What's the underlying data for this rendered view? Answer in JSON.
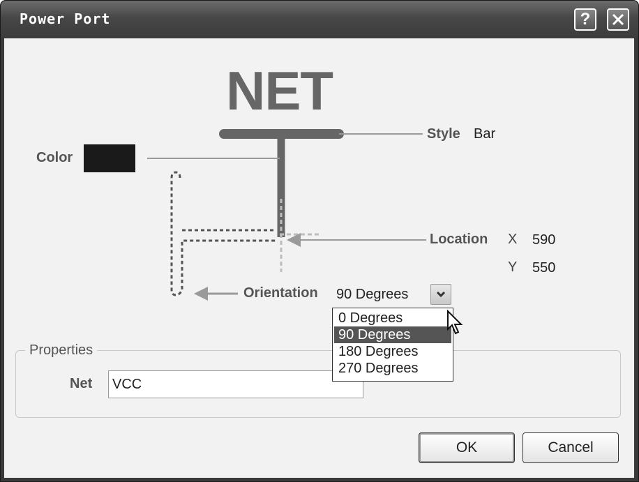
{
  "window": {
    "title": "Power Port",
    "help_label": "?",
    "close_label": "✕"
  },
  "preview": {
    "net_text": "NET"
  },
  "style": {
    "label": "Style",
    "value": "Bar"
  },
  "color": {
    "label": "Color",
    "value": "#1a1a1a"
  },
  "location": {
    "label": "Location",
    "x_label": "X",
    "x_value": "590",
    "y_label": "Y",
    "y_value": "550"
  },
  "orientation": {
    "label": "Orientation",
    "selected": "90 Degrees",
    "options": [
      "0 Degrees",
      "90 Degrees",
      "180 Degrees",
      "270 Degrees"
    ],
    "highlighted_index": 1
  },
  "properties": {
    "group_title": "Properties",
    "net_label": "Net",
    "net_value": "VCC"
  },
  "buttons": {
    "ok": "OK",
    "cancel": "Cancel"
  },
  "colors": {
    "title_bar": "#474747",
    "highlight": "#555555",
    "symbol": "#666666"
  }
}
